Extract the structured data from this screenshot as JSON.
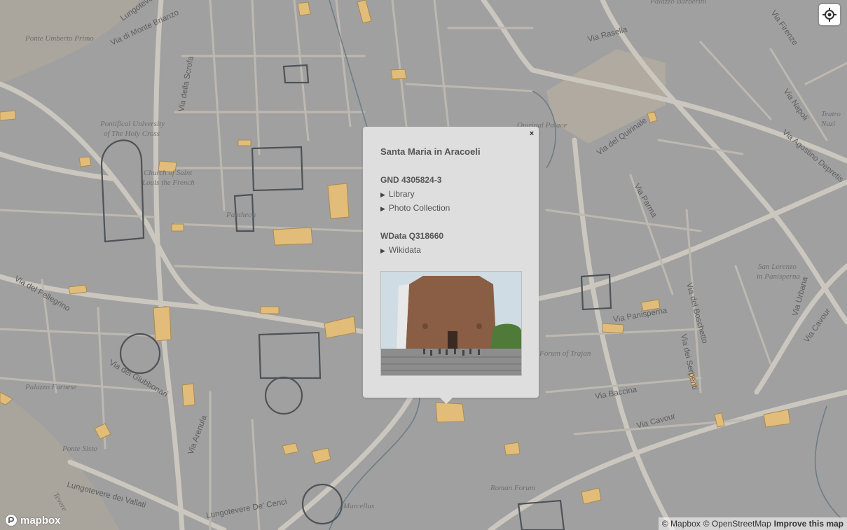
{
  "map": {
    "places": [
      {
        "name": "Pontifical University",
        "line2": "of The Holy Cross"
      },
      {
        "name": "Church of Saint",
        "line2": "Louis the French"
      },
      {
        "name": "Pantheon"
      },
      {
        "name": "Quirinal Palace"
      },
      {
        "name": "Teatro",
        "line2": "Nazi"
      },
      {
        "name": "San Lorenzo",
        "line2": "in Panisperna"
      },
      {
        "name": "Forum of Trajan"
      },
      {
        "name": "Roman Forum"
      },
      {
        "name": "Marcellus"
      },
      {
        "name": "Ponte Umberto Primo"
      },
      {
        "name": "Ponte Sisto"
      },
      {
        "name": "Palazzo Farnese"
      },
      {
        "name": "Palazzo Barberini"
      },
      {
        "name": "Tevere"
      }
    ],
    "streets": [
      "Lungotevere",
      "Via di Monte Brianzo",
      "Via della Scrofa",
      "Via del Pellegrino",
      "Via dei Giubbonari",
      "Via Arenula",
      "Lungotevere dei Vallati",
      "Lungotevere De' Cenci",
      "Via Rasella",
      "Via del Quirinale",
      "Via Firenze",
      "Via Napoli",
      "Via Agostino Depretis",
      "Via Parma",
      "Via Panisperna",
      "Via del Boschetto",
      "Via dei Serpenti",
      "Via Urbana",
      "Via Cavour",
      "Via Baccina",
      "Via Cavour"
    ]
  },
  "popup": {
    "close_label": "×",
    "title": "Santa Maria in Aracoeli",
    "gnd_heading": "GND 4305824-3",
    "gnd_links": [
      "Library",
      "Photo Collection"
    ],
    "wdata_heading": "WData Q318660",
    "wdata_links": [
      "Wikidata"
    ],
    "arrow": "▶"
  },
  "controls": {
    "geolocate_icon": "crosshair-icon"
  },
  "logo": {
    "text": "mapbox"
  },
  "attribution": {
    "mapbox": "© Mapbox",
    "osm": "© OpenStreetMap",
    "improve": "Improve this map"
  }
}
